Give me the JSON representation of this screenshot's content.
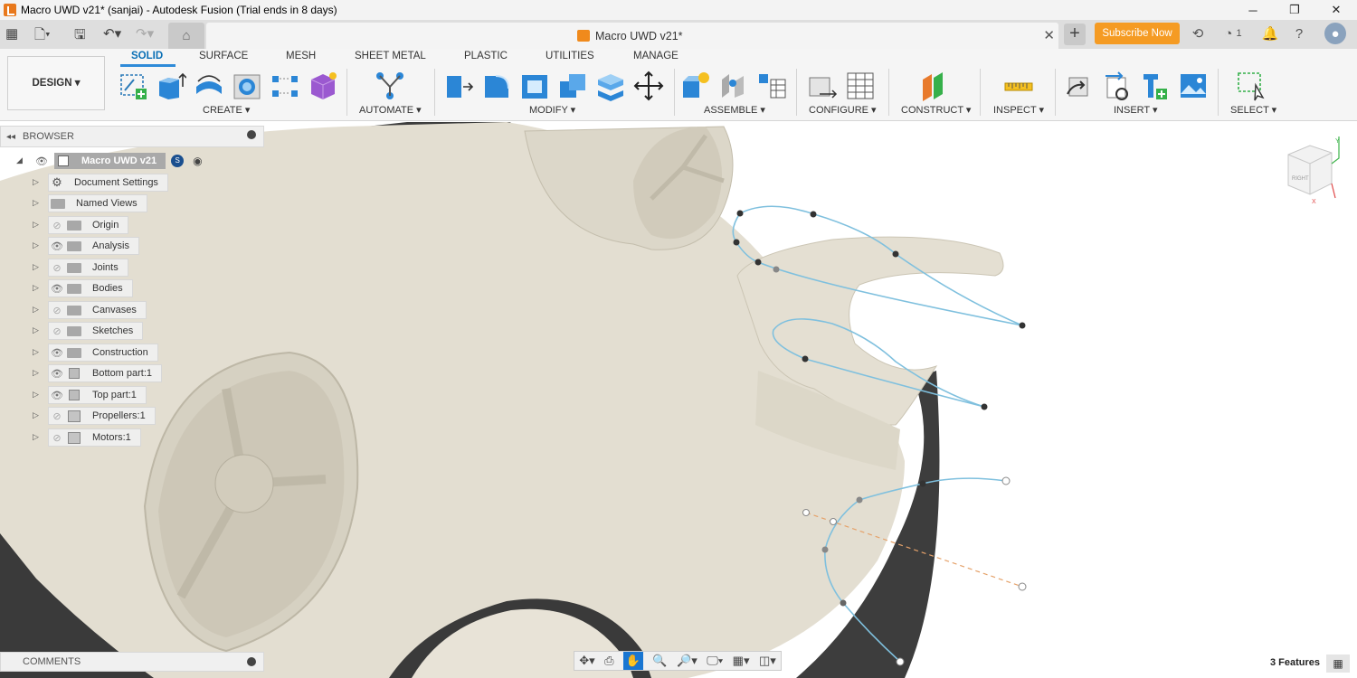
{
  "window": {
    "title": "Macro UWD v21* (sanjai) - Autodesk Fusion (Trial ends in 8 days)",
    "minimize": "─",
    "maximize": "❐",
    "close": "✕"
  },
  "tabbar": {
    "doc_tab": "Macro UWD v21*",
    "subscribe": "Subscribe Now",
    "jobs_count": "1",
    "close_tab": "✕",
    "new_tab": "+"
  },
  "workspace": {
    "label": "DESIGN ▾"
  },
  "ribbon_tabs": [
    "SOLID",
    "SURFACE",
    "MESH",
    "SHEET METAL",
    "PLASTIC",
    "UTILITIES",
    "MANAGE"
  ],
  "groups": {
    "create": "CREATE ▾",
    "automate": "AUTOMATE ▾",
    "modify": "MODIFY ▾",
    "assemble": "ASSEMBLE ▾",
    "configure": "CONFIGURE ▾",
    "construct": "CONSTRUCT ▾",
    "inspect": "INSPECT ▾",
    "insert": "INSERT ▾",
    "select": "SELECT ▾"
  },
  "browser": {
    "title": "BROWSER",
    "root": "Macro UWD v21",
    "items": [
      "Document Settings",
      "Named Views",
      "Origin",
      "Analysis",
      "Joints",
      "Bodies",
      "Canvases",
      "Sketches",
      "Construction",
      "Bottom part:1",
      "Top part:1",
      "Propellers:1",
      "Motors:1"
    ]
  },
  "comments": {
    "title": "COMMENTS"
  },
  "status": {
    "features": "3 Features"
  },
  "viewcube": {
    "face": "RIGHT",
    "axis_x": "X",
    "axis_y": "Y"
  },
  "colors": {
    "accent": "#2e8ad8",
    "subscribe": "#f59b23",
    "model": "#e3ded1",
    "sketch": "#7fc0de"
  }
}
